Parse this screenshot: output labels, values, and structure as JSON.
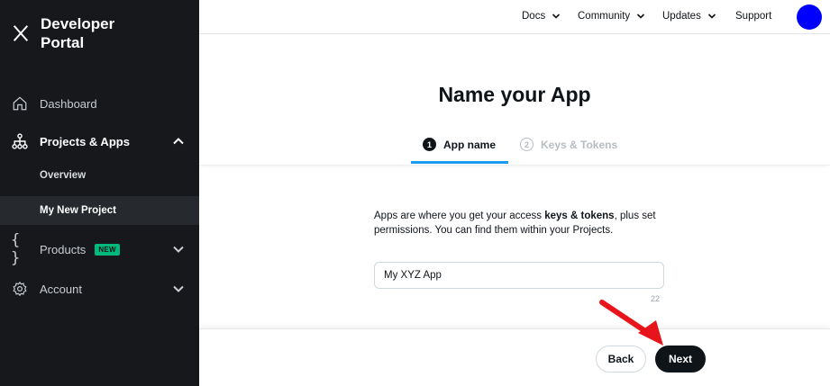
{
  "sidebar": {
    "brand": "Developer Portal",
    "items": [
      {
        "label": "Dashboard",
        "icon": "home-icon"
      },
      {
        "label": "Projects & Apps",
        "icon": "projects-icon"
      },
      {
        "label": "Products",
        "icon": "braces-icon",
        "badge": "NEW"
      },
      {
        "label": "Account",
        "icon": "gear-icon"
      }
    ],
    "sub_items": [
      "Overview",
      "My New Project"
    ]
  },
  "topnav": {
    "links": [
      "Docs",
      "Community",
      "Updates",
      "Support"
    ]
  },
  "main": {
    "title": "Name your App",
    "steps": [
      {
        "num": "1",
        "label": "App name"
      },
      {
        "num": "2",
        "label": "Keys & Tokens"
      }
    ],
    "description_pre": "Apps are where you get your access ",
    "description_bold": "keys & tokens",
    "description_post": ", plus set permissions. You can find them within your Projects.",
    "app_name_value": "My XYZ App",
    "char_count": "22"
  },
  "footer": {
    "back_label": "Back",
    "next_label": "Next"
  },
  "colors": {
    "sidebar_bg": "#16181c",
    "accent": "#1d9bf0",
    "avatar": "#0000ff",
    "badge": "#00ba7c",
    "arrow": "#e8141b"
  }
}
